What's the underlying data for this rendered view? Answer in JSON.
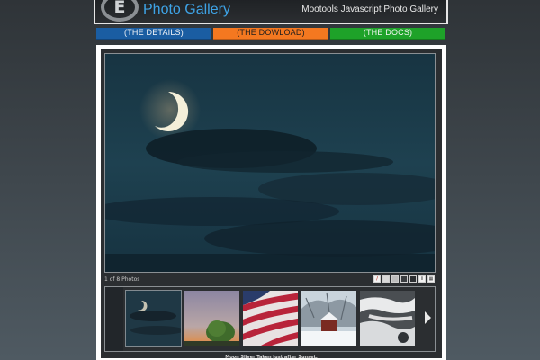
{
  "header": {
    "logo_mark": "E",
    "title": "Photo Gallery",
    "tagline": "Mootools Javascript Photo Gallery"
  },
  "nav": {
    "details": "(THE DETAILS)",
    "download": "(THE DOWLOAD)",
    "docs": "(THE DOCS)"
  },
  "colors": {
    "details_tab": "#1a5da2",
    "download_tab": "#f47820",
    "docs_tab": "#1ea229",
    "title_accent": "#3ea3e6"
  },
  "viewer": {
    "counter": "1 of 8 Photos",
    "caption": "Moon Sliver Taken Just after Sunset.",
    "controls": [
      {
        "icon": "slideshow-icon",
        "glyph": "/"
      },
      {
        "icon": "size-small-icon",
        "glyph": ""
      },
      {
        "icon": "size-medium-icon",
        "glyph": ""
      },
      {
        "icon": "size-large-icon",
        "glyph": ""
      },
      {
        "icon": "size-full-icon",
        "glyph": ""
      },
      {
        "icon": "info-icon",
        "glyph": "i"
      },
      {
        "icon": "grid-icon",
        "glyph": "▦"
      }
    ]
  },
  "thumbnails": [
    {
      "name": "moon-sliver",
      "active": true
    },
    {
      "name": "tree-at-dusk",
      "active": false
    },
    {
      "name": "flag",
      "active": false
    },
    {
      "name": "snowy-barn",
      "active": false
    },
    {
      "name": "winter-stream",
      "active": false
    }
  ]
}
